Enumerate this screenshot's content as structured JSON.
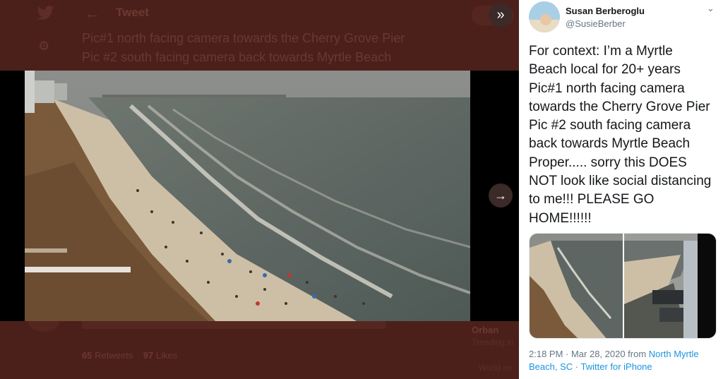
{
  "background": {
    "header_title": "Tweet",
    "text_line1": "Pic#1 north facing camera towards the Cherry Grove Pier",
    "text_line2": "Pic #2 south facing camera back towards Myrtle Beach",
    "retweets_count": "65",
    "retweets_label": "Retweets",
    "likes_count": "97",
    "likes_label": "Likes",
    "trend_title": "Orban",
    "trend_sub": "Trending in",
    "trend_sub2": "World ne"
  },
  "viewer": {
    "close_icon": "double-chevron-right-icon",
    "next_icon": "arrow-right-icon"
  },
  "tweet": {
    "name": "Susan Berberoglu",
    "handle": "@SusieBerber",
    "lines": [
      "For context: I’m a Myrtle",
      "Beach local for 20+ years",
      "Pic#1 north facing camera",
      "towards the Cherry Grove Pier",
      "Pic #2 south facing camera",
      "back towards Myrtle Beach",
      "Proper..... sorry this DOES",
      "NOT look like social distancing",
      "to me!!! PLEASE GO",
      "HOME!!!!!!"
    ],
    "time": "2:18 PM · Mar 28, 2020 from ",
    "location": "North Myrtle Beach, SC",
    "separator": " · ",
    "source": "Twitter for iPhone"
  },
  "colors": {
    "accent": "#1b95e0",
    "overlay": "#4b201b"
  }
}
